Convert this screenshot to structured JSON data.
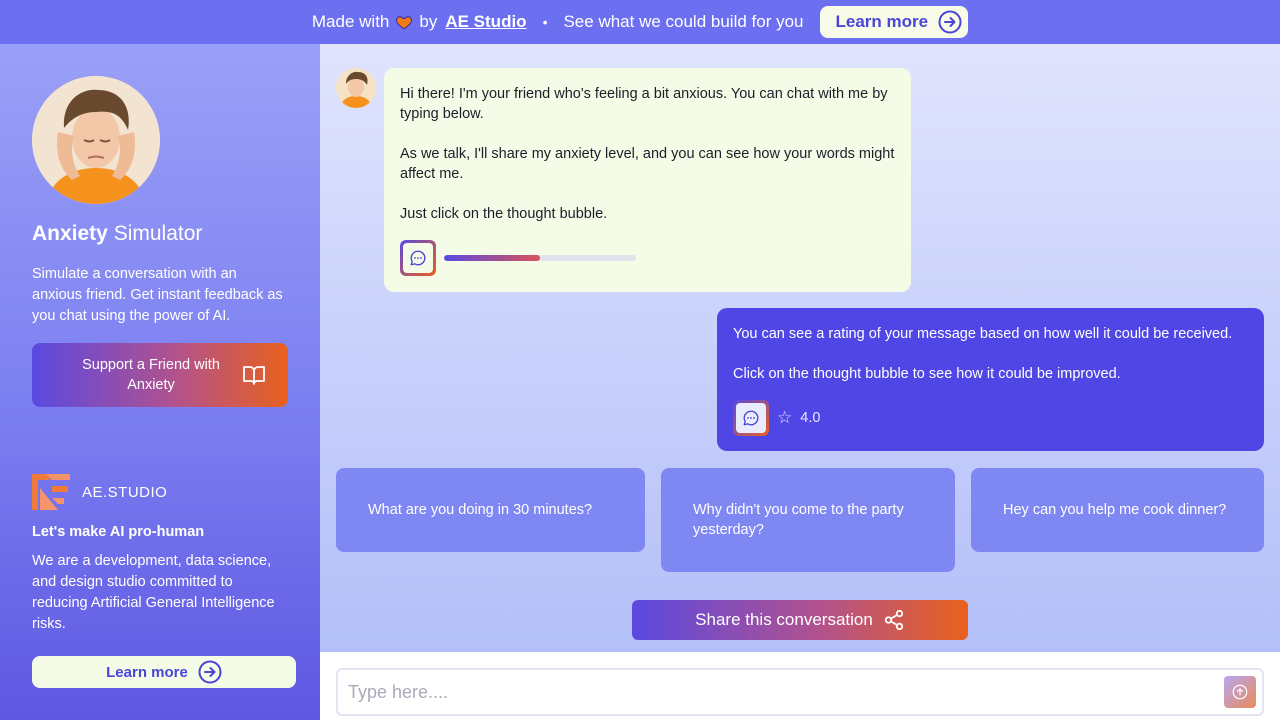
{
  "banner": {
    "made_with": "Made with",
    "by": "by",
    "studio": "AE Studio",
    "separator": "•",
    "pitch": "See what we could build for you",
    "learn_more": "Learn more"
  },
  "sidebar": {
    "title_bold": "Anxiety",
    "title_rest": " Simulator",
    "description": "Simulate a conversation with an anxious friend. Get instant feedback as you chat using the power of AI.",
    "support_button": "Support a Friend with Anxiety",
    "brand_name": "AE.STUDIO",
    "tagline": "Let's make AI pro-human",
    "about": "We are a development, data science, and design studio committed to reducing Artificial General Intelligence risks.",
    "learn_more": "Learn more"
  },
  "chat": {
    "bot_message": {
      "paragraphs": [
        "Hi there! I'm your friend who's feeling a bit anxious. You can chat with me by typing below.",
        "As we talk, I'll share my anxiety level, and you can see how your words might affect me.",
        "Just click on the thought bubble."
      ],
      "anxiety_level": 0.5
    },
    "user_message": {
      "paragraphs": [
        "You can see a rating of your message based on how well it could be received.",
        "Click on the thought bubble to see how it could be improved."
      ],
      "rating": "4.0"
    },
    "suggestions": [
      "What are you doing in 30 minutes?",
      "Why didn't you come to the party yesterday?",
      "Hey can you help me cook dinner?"
    ],
    "share_button": "Share this conversation"
  },
  "input": {
    "placeholder": "Type here....",
    "value": ""
  },
  "icons": {
    "heart": "heart-icon",
    "arrow": "arrow-right-circle-icon",
    "book": "book-open-icon",
    "thought": "thought-bubble-icon",
    "star": "star-icon",
    "share": "share-icon",
    "send": "send-icon"
  },
  "colors": {
    "accent": "#4f46e5",
    "banner": "#6b6ff0",
    "orange": "#e9611d",
    "cream": "#f4fbe6"
  }
}
